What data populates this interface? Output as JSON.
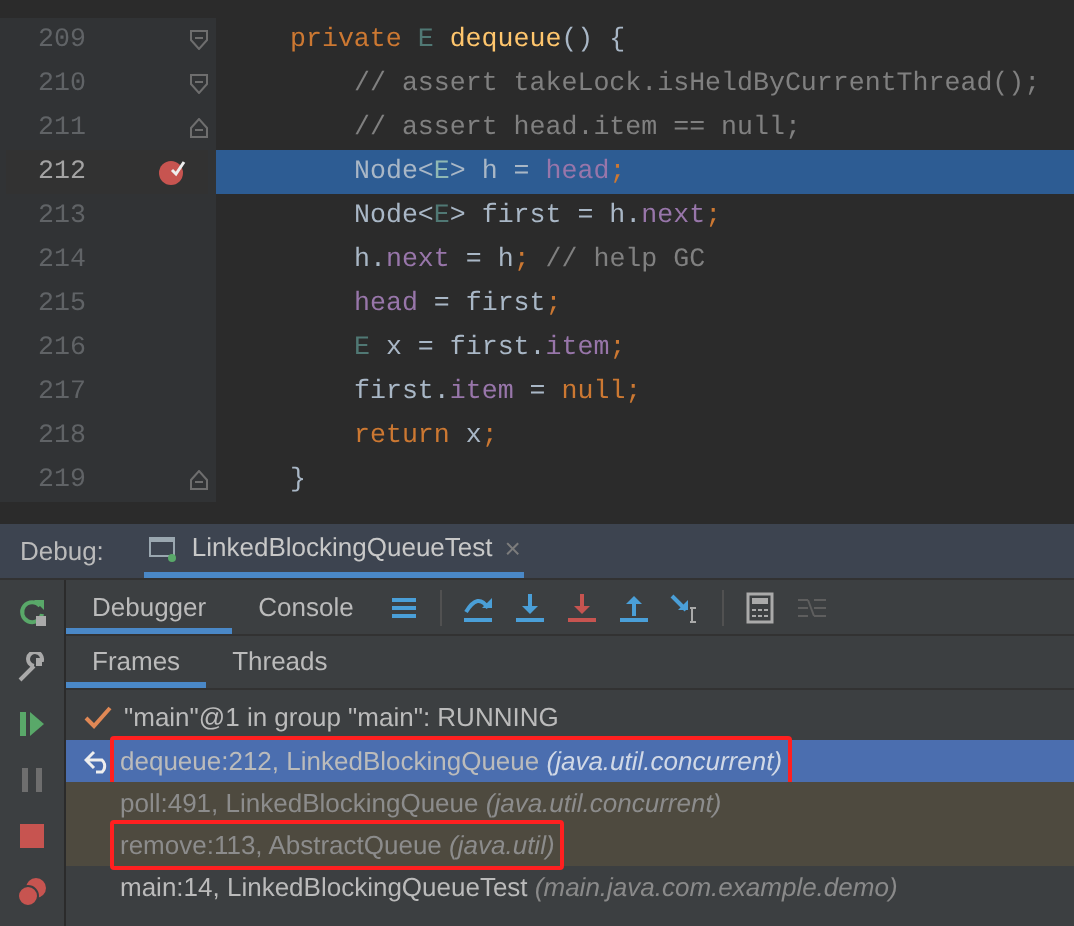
{
  "editor": {
    "lines": [
      {
        "number": "209",
        "current": false,
        "fold": {
          "kind": "start"
        },
        "breakpoint": false,
        "indented": false,
        "tokens": [
          {
            "t": "private ",
            "kind": "kw"
          },
          {
            "t": "E ",
            "kind": "tp"
          },
          {
            "t": "dequeue",
            "kind": "fn"
          },
          {
            "t": "() {",
            "kind": "pl"
          }
        ]
      },
      {
        "number": "210",
        "current": false,
        "fold": {
          "kind": "start"
        },
        "breakpoint": false,
        "indented": true,
        "tokens": [
          {
            "t": "// assert takeLock.isHeldByCurrentThread();",
            "kind": "cm"
          }
        ]
      },
      {
        "number": "211",
        "current": false,
        "fold": {
          "kind": "end"
        },
        "breakpoint": false,
        "indented": true,
        "tokens": [
          {
            "t": "// assert head.item == null;",
            "kind": "cm"
          }
        ]
      },
      {
        "number": "212",
        "current": true,
        "breakpoint": true,
        "indented": true,
        "tokens": [
          {
            "t": "Node<",
            "kind": "pl"
          },
          {
            "t": "E",
            "kind": "tp"
          },
          {
            "t": "> h = ",
            "kind": "pl"
          },
          {
            "t": "head",
            "kind": "fd"
          },
          {
            "t": ";",
            "kind": "kw"
          }
        ]
      },
      {
        "number": "213",
        "current": false,
        "breakpoint": false,
        "indented": true,
        "tokens": [
          {
            "t": "Node<",
            "kind": "pl"
          },
          {
            "t": "E",
            "kind": "tp"
          },
          {
            "t": "> first = h.",
            "kind": "pl"
          },
          {
            "t": "next",
            "kind": "fd"
          },
          {
            "t": ";",
            "kind": "kw"
          }
        ]
      },
      {
        "number": "214",
        "current": false,
        "breakpoint": false,
        "indented": true,
        "tokens": [
          {
            "t": "h.",
            "kind": "pl"
          },
          {
            "t": "next",
            "kind": "fd"
          },
          {
            "t": " = h",
            "kind": "pl"
          },
          {
            "t": ";",
            "kind": "kw"
          },
          {
            "t": " // help GC",
            "kind": "cm"
          }
        ]
      },
      {
        "number": "215",
        "current": false,
        "breakpoint": false,
        "indented": true,
        "tokens": [
          {
            "t": "head",
            "kind": "fd"
          },
          {
            "t": " = first",
            "kind": "pl"
          },
          {
            "t": ";",
            "kind": "kw"
          }
        ]
      },
      {
        "number": "216",
        "current": false,
        "breakpoint": false,
        "indented": true,
        "tokens": [
          {
            "t": "E",
            "kind": "tp"
          },
          {
            "t": " x = first.",
            "kind": "pl"
          },
          {
            "t": "item",
            "kind": "fd"
          },
          {
            "t": ";",
            "kind": "kw"
          }
        ]
      },
      {
        "number": "217",
        "current": false,
        "breakpoint": false,
        "indented": true,
        "tokens": [
          {
            "t": "first.",
            "kind": "pl"
          },
          {
            "t": "item",
            "kind": "fd"
          },
          {
            "t": " = ",
            "kind": "pl"
          },
          {
            "t": "null;",
            "kind": "kw"
          }
        ]
      },
      {
        "number": "218",
        "current": false,
        "breakpoint": false,
        "indented": true,
        "tokens": [
          {
            "t": "return ",
            "kind": "kw"
          },
          {
            "t": "x",
            "kind": "pl"
          },
          {
            "t": ";",
            "kind": "kw"
          }
        ]
      },
      {
        "number": "219",
        "current": false,
        "fold": {
          "kind": "end"
        },
        "breakpoint": false,
        "indented": false,
        "tokens": [
          {
            "t": "}",
            "kind": "pl"
          }
        ]
      }
    ]
  },
  "debug": {
    "label": "Debug:",
    "session_tab": {
      "title": "LinkedBlockingQueueTest",
      "close": "×"
    },
    "tabs": [
      {
        "label": "Debugger",
        "selected": true
      },
      {
        "label": "Console",
        "selected": false
      }
    ],
    "subtabs": [
      {
        "label": "Frames",
        "selected": true
      },
      {
        "label": "Threads",
        "selected": false
      }
    ],
    "thread": "\"main\"@1 in group \"main\": RUNNING",
    "frames": [
      {
        "method": "dequeue:212, LinkedBlockingQueue",
        "package": "(java.util.concurrent)",
        "selected": true,
        "library": false,
        "boxed": true
      },
      {
        "method": "poll:491, LinkedBlockingQueue",
        "package": "(java.util.concurrent)",
        "selected": false,
        "library": true,
        "boxed": false
      },
      {
        "method": "remove:113, AbstractQueue",
        "package": "(java.util)",
        "selected": false,
        "library": true,
        "boxed": true
      },
      {
        "method": "main:14, LinkedBlockingQueueTest",
        "package": "(main.java.com.example.demo)",
        "selected": false,
        "library": false,
        "boxed": false
      }
    ]
  }
}
